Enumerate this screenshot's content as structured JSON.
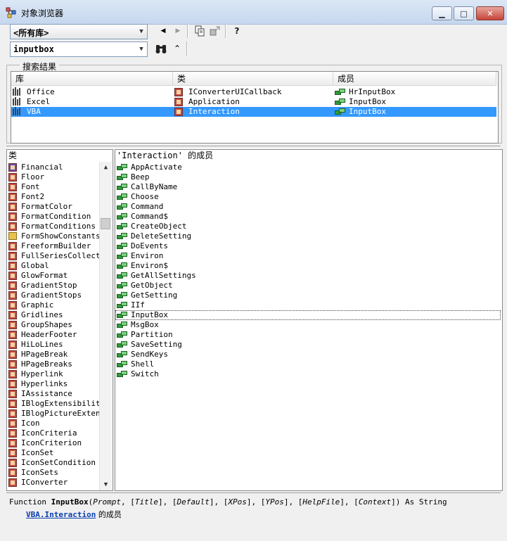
{
  "window": {
    "title": "对象浏览器",
    "min_icon": "minimize-icon",
    "max_icon": "maximize-icon",
    "close_icon": "close-icon"
  },
  "toolbar": {
    "library_select": "<所有库>",
    "search_text": "inputbox",
    "back_icon": "◀",
    "forward_icon": "▶",
    "copy_icon": "copy-icon",
    "view_definition_icon": "view-definition-icon",
    "help_icon": "?",
    "search_icon": "binoculars-icon",
    "collapse_icon": "⌃"
  },
  "search_results": {
    "group_label": "搜索结果",
    "columns": [
      "库",
      "类",
      "成员"
    ],
    "rows": [
      {
        "library": "Office",
        "class": "IConverterUICallback",
        "member": "HrInputBox",
        "selected": false
      },
      {
        "library": "Excel",
        "class": "Application",
        "member": "InputBox",
        "selected": false
      },
      {
        "library": "VBA",
        "class": "Interaction",
        "member": "InputBox",
        "selected": true
      }
    ]
  },
  "classes": {
    "header": "类",
    "items": [
      {
        "name": "Financial",
        "icon": "module"
      },
      {
        "name": "Floor",
        "icon": "class"
      },
      {
        "name": "Font",
        "icon": "class"
      },
      {
        "name": "Font2",
        "icon": "class"
      },
      {
        "name": "FormatColor",
        "icon": "class"
      },
      {
        "name": "FormatCondition",
        "icon": "class"
      },
      {
        "name": "FormatConditions",
        "icon": "class"
      },
      {
        "name": "FormShowConstants",
        "icon": "enum"
      },
      {
        "name": "FreeformBuilder",
        "icon": "class"
      },
      {
        "name": "FullSeriesCollection",
        "icon": "class"
      },
      {
        "name": "Global",
        "icon": "class"
      },
      {
        "name": "GlowFormat",
        "icon": "class"
      },
      {
        "name": "GradientStop",
        "icon": "class"
      },
      {
        "name": "GradientStops",
        "icon": "class"
      },
      {
        "name": "Graphic",
        "icon": "class"
      },
      {
        "name": "Gridlines",
        "icon": "class"
      },
      {
        "name": "GroupShapes",
        "icon": "class"
      },
      {
        "name": "HeaderFooter",
        "icon": "class"
      },
      {
        "name": "HiLoLines",
        "icon": "class"
      },
      {
        "name": "HPageBreak",
        "icon": "class"
      },
      {
        "name": "HPageBreaks",
        "icon": "class"
      },
      {
        "name": "Hyperlink",
        "icon": "class"
      },
      {
        "name": "Hyperlinks",
        "icon": "class"
      },
      {
        "name": "IAssistance",
        "icon": "class"
      },
      {
        "name": "IBlogExtensibility",
        "icon": "class"
      },
      {
        "name": "IBlogPictureExtensibility",
        "icon": "class"
      },
      {
        "name": "Icon",
        "icon": "class"
      },
      {
        "name": "IconCriteria",
        "icon": "class"
      },
      {
        "name": "IconCriterion",
        "icon": "class"
      },
      {
        "name": "IconSet",
        "icon": "class"
      },
      {
        "name": "IconSetCondition",
        "icon": "class"
      },
      {
        "name": "IconSets",
        "icon": "class"
      },
      {
        "name": "IConverter",
        "icon": "class"
      }
    ]
  },
  "members": {
    "header": "'Interaction' 的成员",
    "items": [
      "AppActivate",
      "Beep",
      "CallByName",
      "Choose",
      "Command",
      "Command$",
      "CreateObject",
      "DeleteSetting",
      "DoEvents",
      "Environ",
      "Environ$",
      "GetAllSettings",
      "GetObject",
      "GetSetting",
      "IIf",
      "InputBox",
      "MsgBox",
      "Partition",
      "SaveSetting",
      "SendKeys",
      "Shell",
      "Switch"
    ],
    "focused": "InputBox"
  },
  "details": {
    "keyword": "Function ",
    "function_name": "InputBox",
    "open_paren": "(",
    "p1": "Prompt",
    "sep1": ", [",
    "p2": "Title",
    "sep2": "], [",
    "p3": "Default",
    "sep3": "], [",
    "p4": "XPos",
    "sep4": "], [",
    "p5": "YPos",
    "sep5": "], [",
    "p6": "HelpFile",
    "sep6": "], [",
    "p7": "Context",
    "tail": "]) As String",
    "lib_link": "VBA",
    "dot": ".",
    "class_link": "Interaction",
    "member_of": " 的成员"
  }
}
